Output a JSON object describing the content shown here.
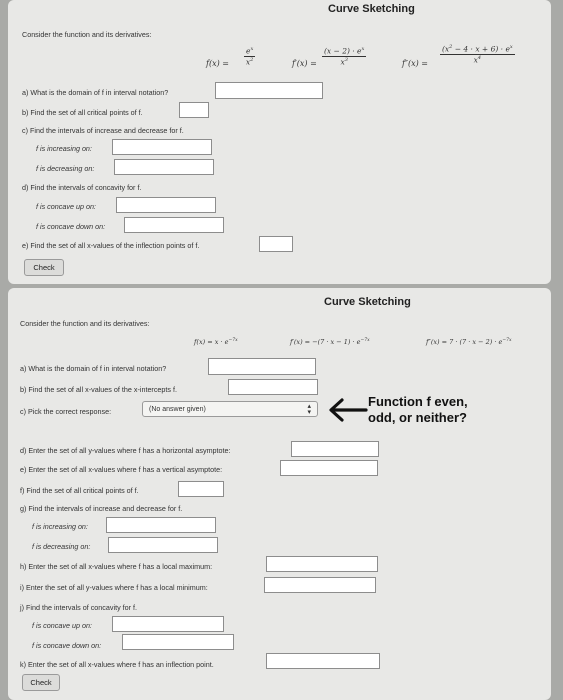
{
  "panel1": {
    "title": "Curve Sketching",
    "intro": "Consider the function and its derivatives:",
    "f_lhs": "f(x) =",
    "f_num": "e",
    "f_num_sup": "x",
    "f_den": "x",
    "f_den_sup": "2",
    "fp_lhs": "f′(x) =",
    "fp_num": "(x − 2) · e",
    "fp_num_sup": "x",
    "fp_den": "x",
    "fp_den_sup": "3",
    "fpp_lhs": "f″(x) =",
    "fpp_num": "(x",
    "fpp_num_sup": "2",
    "fpp_num_rest": " − 4 · x + 6) · e",
    "fpp_num_sup2": "x",
    "fpp_den": "x",
    "fpp_den_sup": "4",
    "qa": "a)  What is the domain of  f  in interval notation?",
    "qb": "b)  Find the set of all critical points of  f.",
    "qc": "c)  Find the intervals of increase and decrease for  f.",
    "qc1": "f  is increasing on:",
    "qc2": "f  is decreasing on:",
    "qd": "d)  Find the intervals of concavity for  f.",
    "qd1": "f  is concave up on:",
    "qd2": "f  is concave down on:",
    "qe": "e)  Find the set of all x-values of the inflection points of  f.",
    "check": "Check"
  },
  "panel2": {
    "title": "Curve Sketching",
    "intro": "Consider the function and its derivatives:",
    "f": "f(x) = x · e",
    "f_sup": "−7x",
    "fp": "f′(x) = −(7 · x − 1) · e",
    "fp_sup": "−7x",
    "fpp": "f″(x) = 7 · (7 · x − 2) · e",
    "fpp_sup": "−7x",
    "qa": "a)  What is the domain of  f  in interval notation?",
    "qb": "b)  Find the set of all x-values of the x-intercepts  f.",
    "qc": "c)  Pick the correct response:",
    "qc_select": "(No answer given)",
    "note": "Function f even,\nodd, or neither?",
    "qd": "d)  Enter the set of all y-values where  f  has a horizontal asymptote:",
    "qe": "e)  Enter the set of all x-values where  f  has a vertical asymptote:",
    "qf": "f)  Find the set of all critical points of  f.",
    "qg": "g)  Find the intervals of increase and decrease for  f.",
    "qg1": "f  is increasing on:",
    "qg2": "f  is decreasing on:",
    "qh": "h)  Enter the set of all x-values where  f  has a local maximum:",
    "qi": "i)  Enter the set of all y-values where  f  has a local minimum:",
    "qj": "j)  Find the intervals of concavity for  f.",
    "qj1": "f  is concave up on:",
    "qj2": "f  is concave down on:",
    "qk": "k)  Enter the set of all x-values where  f  has an inflection point.",
    "check": "Check"
  },
  "icons": {
    "arrow": "left-arrow-icon",
    "select_caret": "updown-caret-icon"
  }
}
